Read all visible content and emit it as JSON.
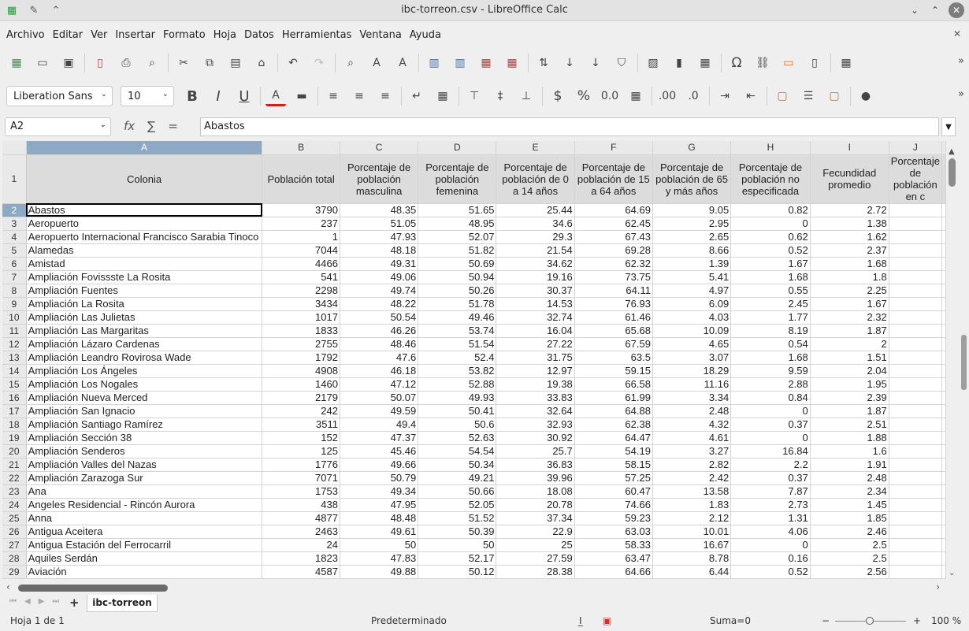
{
  "window": {
    "title": "ibc-torreon.csv - LibreOffice Calc"
  },
  "menu": [
    "Archivo",
    "Editar",
    "Ver",
    "Insertar",
    "Formato",
    "Hoja",
    "Datos",
    "Herramientas",
    "Ventana",
    "Ayuda"
  ],
  "format_toolbar": {
    "font_name": "Liberation Sans",
    "font_size": "10"
  },
  "formula_bar": {
    "name_box": "A2",
    "content": "Abastos"
  },
  "columns": [
    "A",
    "B",
    "C",
    "D",
    "E",
    "F",
    "G",
    "H",
    "I",
    "J"
  ],
  "header_row": {
    "number": "1",
    "cells": [
      "Colonia",
      "Población total",
      "Porcentaje de población masculina",
      "Porcentaje de población femenina",
      "Porcentaje de población de 0 a 14 años",
      "Porcentaje de población de 15 a 64 años",
      "Porcentaje de población de 65 y más años",
      "Porcentaje de población no especificada",
      "Fecundidad promedio",
      "Porcentaje de población en c"
    ]
  },
  "rows": [
    {
      "n": "2",
      "cells": [
        "Abastos",
        "3790",
        "48.35",
        "51.65",
        "25.44",
        "64.69",
        "9.05",
        "0.82",
        "2.72",
        ""
      ]
    },
    {
      "n": "3",
      "cells": [
        "Aeropuerto",
        "237",
        "51.05",
        "48.95",
        "34.6",
        "62.45",
        "2.95",
        "0",
        "1.38",
        ""
      ]
    },
    {
      "n": "4",
      "cells": [
        "Aeropuerto Internacional Francisco Sarabia Tinoco",
        "1",
        "47.93",
        "52.07",
        "29.3",
        "67.43",
        "2.65",
        "0.62",
        "1.62",
        ""
      ]
    },
    {
      "n": "5",
      "cells": [
        "Alamedas",
        "7044",
        "48.18",
        "51.82",
        "21.54",
        "69.28",
        "8.66",
        "0.52",
        "2.37",
        ""
      ]
    },
    {
      "n": "6",
      "cells": [
        "Amistad",
        "4466",
        "49.31",
        "50.69",
        "34.62",
        "62.32",
        "1.39",
        "1.67",
        "1.68",
        ""
      ]
    },
    {
      "n": "7",
      "cells": [
        "Ampliación Fovissste La Rosita",
        "541",
        "49.06",
        "50.94",
        "19.16",
        "73.75",
        "5.41",
        "1.68",
        "1.8",
        ""
      ]
    },
    {
      "n": "8",
      "cells": [
        "Ampliación Fuentes",
        "2298",
        "49.74",
        "50.26",
        "30.37",
        "64.11",
        "4.97",
        "0.55",
        "2.25",
        ""
      ]
    },
    {
      "n": "9",
      "cells": [
        "Ampliación La Rosita",
        "3434",
        "48.22",
        "51.78",
        "14.53",
        "76.93",
        "6.09",
        "2.45",
        "1.67",
        ""
      ]
    },
    {
      "n": "10",
      "cells": [
        "Ampliación Las Julietas",
        "1017",
        "50.54",
        "49.46",
        "32.74",
        "61.46",
        "4.03",
        "1.77",
        "2.32",
        ""
      ]
    },
    {
      "n": "11",
      "cells": [
        "Ampliación Las Margaritas",
        "1833",
        "46.26",
        "53.74",
        "16.04",
        "65.68",
        "10.09",
        "8.19",
        "1.87",
        ""
      ]
    },
    {
      "n": "12",
      "cells": [
        "Ampliación Lázaro Cardenas",
        "2755",
        "48.46",
        "51.54",
        "27.22",
        "67.59",
        "4.65",
        "0.54",
        "2",
        ""
      ]
    },
    {
      "n": "13",
      "cells": [
        "Ampliación Leandro Rovirosa Wade",
        "1792",
        "47.6",
        "52.4",
        "31.75",
        "63.5",
        "3.07",
        "1.68",
        "1.51",
        ""
      ]
    },
    {
      "n": "14",
      "cells": [
        "Ampliación Los Ángeles",
        "4908",
        "46.18",
        "53.82",
        "12.97",
        "59.15",
        "18.29",
        "9.59",
        "2.04",
        ""
      ]
    },
    {
      "n": "15",
      "cells": [
        "Ampliación Los Nogales",
        "1460",
        "47.12",
        "52.88",
        "19.38",
        "66.58",
        "11.16",
        "2.88",
        "1.95",
        ""
      ]
    },
    {
      "n": "16",
      "cells": [
        "Ampliación Nueva Merced",
        "2179",
        "50.07",
        "49.93",
        "33.83",
        "61.99",
        "3.34",
        "0.84",
        "2.39",
        ""
      ]
    },
    {
      "n": "17",
      "cells": [
        "Ampliación San Ignacio",
        "242",
        "49.59",
        "50.41",
        "32.64",
        "64.88",
        "2.48",
        "0",
        "1.87",
        ""
      ]
    },
    {
      "n": "18",
      "cells": [
        "Ampliación Santiago Ramírez",
        "3511",
        "49.4",
        "50.6",
        "32.93",
        "62.38",
        "4.32",
        "0.37",
        "2.51",
        ""
      ]
    },
    {
      "n": "19",
      "cells": [
        "Ampliación Sección 38",
        "152",
        "47.37",
        "52.63",
        "30.92",
        "64.47",
        "4.61",
        "0",
        "1.88",
        ""
      ]
    },
    {
      "n": "20",
      "cells": [
        "Ampliación Senderos",
        "125",
        "45.46",
        "54.54",
        "25.7",
        "54.19",
        "3.27",
        "16.84",
        "1.6",
        ""
      ]
    },
    {
      "n": "21",
      "cells": [
        "Ampliación Valles del Nazas",
        "1776",
        "49.66",
        "50.34",
        "36.83",
        "58.15",
        "2.82",
        "2.2",
        "1.91",
        ""
      ]
    },
    {
      "n": "22",
      "cells": [
        "Ampliación Zarazoga Sur",
        "7071",
        "50.79",
        "49.21",
        "39.96",
        "57.25",
        "2.42",
        "0.37",
        "2.48",
        ""
      ]
    },
    {
      "n": "23",
      "cells": [
        "Ana",
        "1753",
        "49.34",
        "50.66",
        "18.08",
        "60.47",
        "13.58",
        "7.87",
        "2.34",
        ""
      ]
    },
    {
      "n": "24",
      "cells": [
        "Angeles Residencial - Rincón Aurora",
        "438",
        "47.95",
        "52.05",
        "20.78",
        "74.66",
        "1.83",
        "2.73",
        "1.45",
        ""
      ]
    },
    {
      "n": "25",
      "cells": [
        "Anna",
        "4877",
        "48.48",
        "51.52",
        "37.34",
        "59.23",
        "2.12",
        "1.31",
        "1.85",
        ""
      ]
    },
    {
      "n": "26",
      "cells": [
        "Antigua Aceitera",
        "2463",
        "49.61",
        "50.39",
        "22.9",
        "63.03",
        "10.01",
        "4.06",
        "2.46",
        ""
      ]
    },
    {
      "n": "27",
      "cells": [
        "Antigua Estación del Ferrocarril",
        "24",
        "50",
        "50",
        "25",
        "58.33",
        "16.67",
        "0",
        "2.5",
        ""
      ]
    },
    {
      "n": "28",
      "cells": [
        "Aquiles Serdán",
        "1823",
        "47.83",
        "52.17",
        "27.59",
        "63.47",
        "8.78",
        "0.16",
        "2.5",
        ""
      ]
    },
    {
      "n": "29",
      "cells": [
        "Aviación",
        "4587",
        "49.88",
        "50.12",
        "28.38",
        "64.66",
        "6.44",
        "0.52",
        "2.56",
        ""
      ]
    }
  ],
  "sheet_tab": "ibc-torreon",
  "status": {
    "sheet": "Hoja 1 de 1",
    "style": "Predeterminado",
    "sum": "Suma=0",
    "zoom": "100 %"
  }
}
